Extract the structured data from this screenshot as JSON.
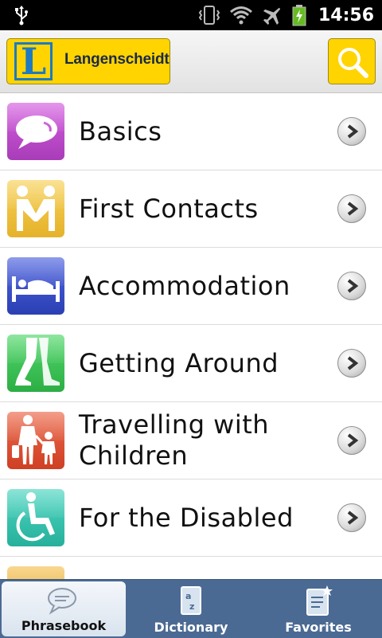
{
  "status_bar": {
    "time": "14:56"
  },
  "header": {
    "logo_letter": "L",
    "brand_name": "Langenscheidt"
  },
  "categories": [
    {
      "label": "Basics",
      "icon": "speech-bubble-icon",
      "color": "#c44fcf"
    },
    {
      "label": "First Contacts",
      "icon": "handshake-icon",
      "color": "#f0c43a"
    },
    {
      "label": "Accommodation",
      "icon": "bed-icon",
      "color": "#3c55d0"
    },
    {
      "label": "Getting Around",
      "icon": "walking-legs-icon",
      "color": "#3cc95a"
    },
    {
      "label": "Travelling with Children",
      "icon": "family-icon",
      "color": "#e2573b"
    },
    {
      "label": "For the Disabled",
      "icon": "wheelchair-icon",
      "color": "#39c7b2"
    },
    {
      "label": "",
      "icon": "partial-icon",
      "color": "#f0b43a"
    }
  ],
  "tabs": [
    {
      "label": "Phrasebook",
      "icon": "speech-bubbles-icon",
      "active": true
    },
    {
      "label": "Dictionary",
      "icon": "az-book-icon",
      "active": false
    },
    {
      "label": "Favorites",
      "icon": "starred-note-icon",
      "active": false
    }
  ],
  "colors": {
    "brand_yellow": "#ffd400",
    "brand_blue": "#1f7abf",
    "tabbar": "#4b6a93"
  }
}
